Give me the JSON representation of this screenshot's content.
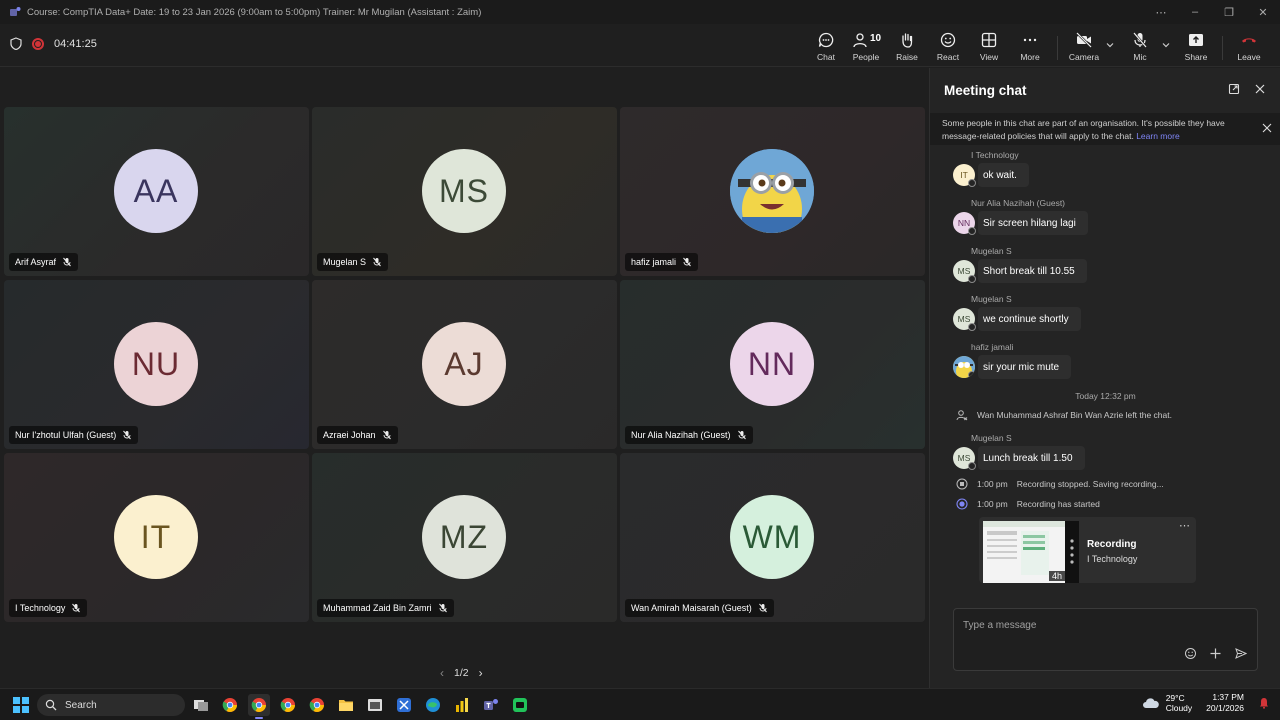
{
  "window": {
    "title": "Course: CompTIA Data+ Date: 19 to 23 Jan 2026 (9:00am to 5:00pm) Trainer: Mr Mugilan (Assistant : Zaim)"
  },
  "toolbar": {
    "timer": "04:41:25",
    "people_count": "10",
    "buttons": {
      "chat": "Chat",
      "people": "People",
      "raise": "Raise",
      "react": "React",
      "view": "View",
      "more": "More",
      "camera": "Camera",
      "mic": "Mic",
      "share": "Share",
      "leave": "Leave"
    }
  },
  "participants": [
    {
      "initials": "AA",
      "name": "Arif Asyraf",
      "bg": "#d9d6ee",
      "fg": "#3a355e"
    },
    {
      "initials": "MS",
      "name": "Mugelan S",
      "bg": "#dfe6d9",
      "fg": "#3c4a37"
    },
    {
      "initials": "",
      "name": "hafiz jamali",
      "bg": "#f0d84a",
      "fg": "#333"
    },
    {
      "initials": "NU",
      "name": "Nur I'zhotul Ulfah (Guest)",
      "bg": "#ecd3d6",
      "fg": "#6b2a33"
    },
    {
      "initials": "AJ",
      "name": "Azraei Johan",
      "bg": "#ecdcd6",
      "fg": "#5b3a30"
    },
    {
      "initials": "NN",
      "name": "Nur Alia Nazihah (Guest)",
      "bg": "#ecd6ea",
      "fg": "#632a5c"
    },
    {
      "initials": "IT",
      "name": "I Technology",
      "bg": "#fbf0cf",
      "fg": "#6a5520"
    },
    {
      "initials": "MZ",
      "name": "Muhammad Zaid Bin Zamri",
      "bg": "#dfe3da",
      "fg": "#3b4634"
    },
    {
      "initials": "WM",
      "name": "Wan Amirah Maisarah (Guest)",
      "bg": "#d5f0dd",
      "fg": "#2a5a36"
    }
  ],
  "pager": {
    "label": "1/2"
  },
  "chat": {
    "title": "Meeting chat",
    "notice": "Some people in this chat are part of an organisation. It's possible they have message-related policies that will apply to the chat.",
    "notice_link": "Learn more",
    "messages": [
      {
        "sender": "I Technology",
        "initials": "IT",
        "text": "ok wait.",
        "bg": "#fbf0cf",
        "fg": "#6a5520"
      },
      {
        "sender": "Nur Alia Nazihah (Guest)",
        "initials": "NN",
        "text": "Sir screen hilang lagi",
        "bg": "#ecd6ea",
        "fg": "#632a5c"
      },
      {
        "sender": "Mugelan S",
        "initials": "MS",
        "text": "Short break till 10.55",
        "bg": "#dfe6d9",
        "fg": "#3c4a37"
      },
      {
        "sender": "Mugelan S",
        "initials": "MS",
        "text": "we continue shortly",
        "bg": "#dfe6d9",
        "fg": "#3c4a37"
      },
      {
        "sender": "hafiz jamali",
        "initials": "",
        "text": "sir your mic mute",
        "bg": "#f0d84a",
        "fg": "#333"
      }
    ],
    "day_separator": "Today 12:32 pm",
    "left_event": "Wan Muhammad Ashraf Bin Wan Azrie left the chat.",
    "last_message": {
      "sender": "Mugelan S",
      "initials": "MS",
      "text": "Lunch break till 1.50",
      "bg": "#dfe6d9",
      "fg": "#3c4a37"
    },
    "events": [
      {
        "time": "1:00 pm",
        "text": "Recording stopped. Saving recording..."
      },
      {
        "time": "1:00 pm",
        "text": "Recording has started"
      }
    ],
    "recording": {
      "title": "Recording",
      "owner": "I Technology",
      "duration": "4h"
    },
    "compose_placeholder": "Type a message"
  },
  "taskbar": {
    "search": "Search",
    "temperature": "29°C",
    "weather": "Cloudy",
    "time": "1:37 PM",
    "date": "20/1/2026"
  },
  "colors": {
    "accent": "#7f85f5",
    "leave": "#d13438"
  }
}
